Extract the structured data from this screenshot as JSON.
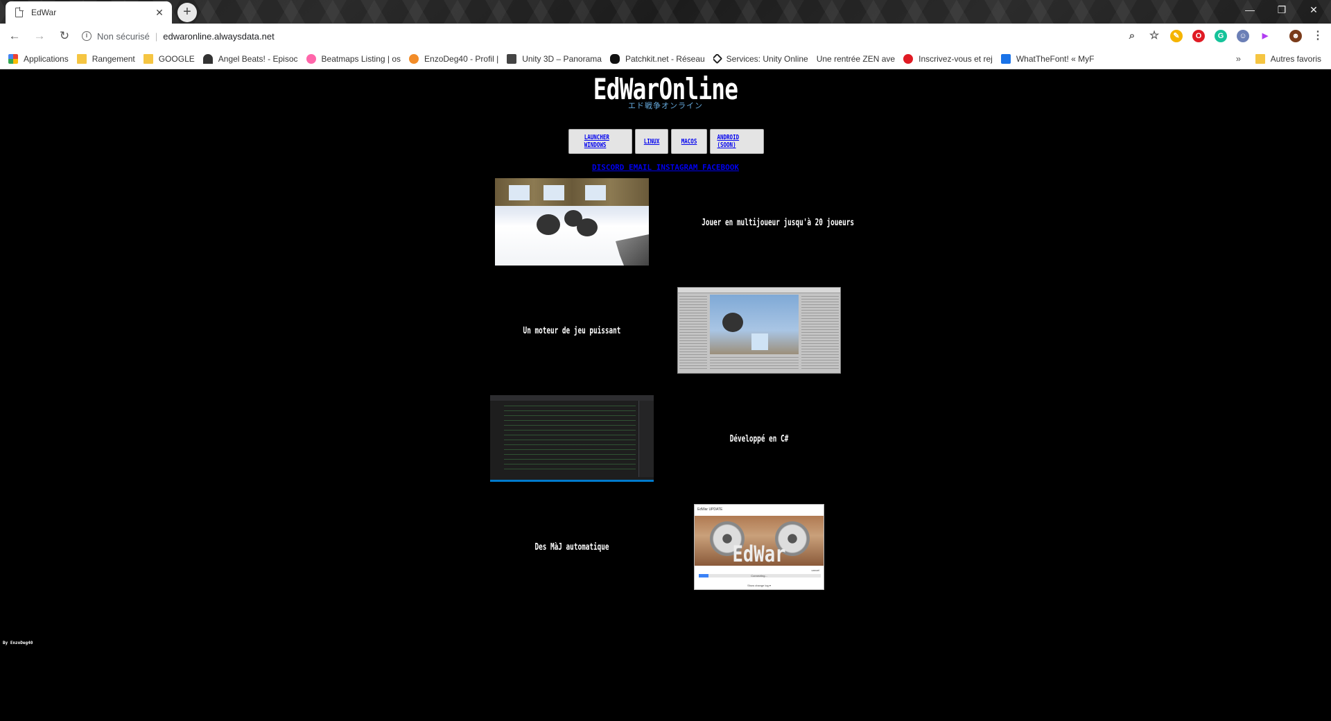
{
  "browser": {
    "tab_title": "EdWar",
    "security_label": "Non sécurisé",
    "url": "edwaronline.alwaysdata.net",
    "bookmarks": [
      {
        "label": "Applications",
        "icon": "apps-grid-icon"
      },
      {
        "label": "Rangement",
        "icon": "folder-icon"
      },
      {
        "label": "GOOGLE",
        "icon": "folder-icon"
      },
      {
        "label": "Angel Beats! - Episoc",
        "icon": "angel-beats-icon"
      },
      {
        "label": "Beatmaps Listing | os",
        "icon": "osu-icon"
      },
      {
        "label": "EnzoDeg40 - Profil | ",
        "icon": "profile-icon"
      },
      {
        "label": "Unity 3D – Panorama",
        "icon": "unity-panorama-icon"
      },
      {
        "label": "Patchkit.net - Réseau",
        "icon": "gamepad-icon"
      },
      {
        "label": "Services: Unity Online",
        "icon": "unity-icon"
      },
      {
        "label": "Une rentrée ZEN ave",
        "icon": "none"
      },
      {
        "label": "Inscrivez-vous et rej",
        "icon": "red-logo-icon"
      },
      {
        "label": "WhatTheFont! « MyF",
        "icon": "whatthefont-icon"
      }
    ],
    "bookmarks_more": "»",
    "other_bookmarks": "Autres favoris"
  },
  "page": {
    "logo": "EdWarOnline",
    "logo_subtitle": "エド戦争オンライン",
    "downloads": [
      {
        "label": "LAUNCHER WINDOWS"
      },
      {
        "label": "LINUX"
      },
      {
        "label": "MACOS"
      },
      {
        "label": "ANDROID (SOON)"
      }
    ],
    "social_links": "DISCORD EMAIL INSTAGRAM FACEBOOK",
    "features": [
      {
        "text": "Jouer en multijoueur jusqu'à 20 joueurs"
      },
      {
        "text": "Un moteur de jeu puissant"
      },
      {
        "text": "Développé en C#"
      },
      {
        "text": "Des MàJ automatique"
      }
    ],
    "updater": {
      "title": "EdWar UPDATE",
      "brand": "EdWar",
      "cancel": "cancel",
      "status": "Connecting...",
      "details": "Show change log ▾",
      "progress": 0.08
    },
    "footer_credit": "By EnzoDeg40"
  }
}
